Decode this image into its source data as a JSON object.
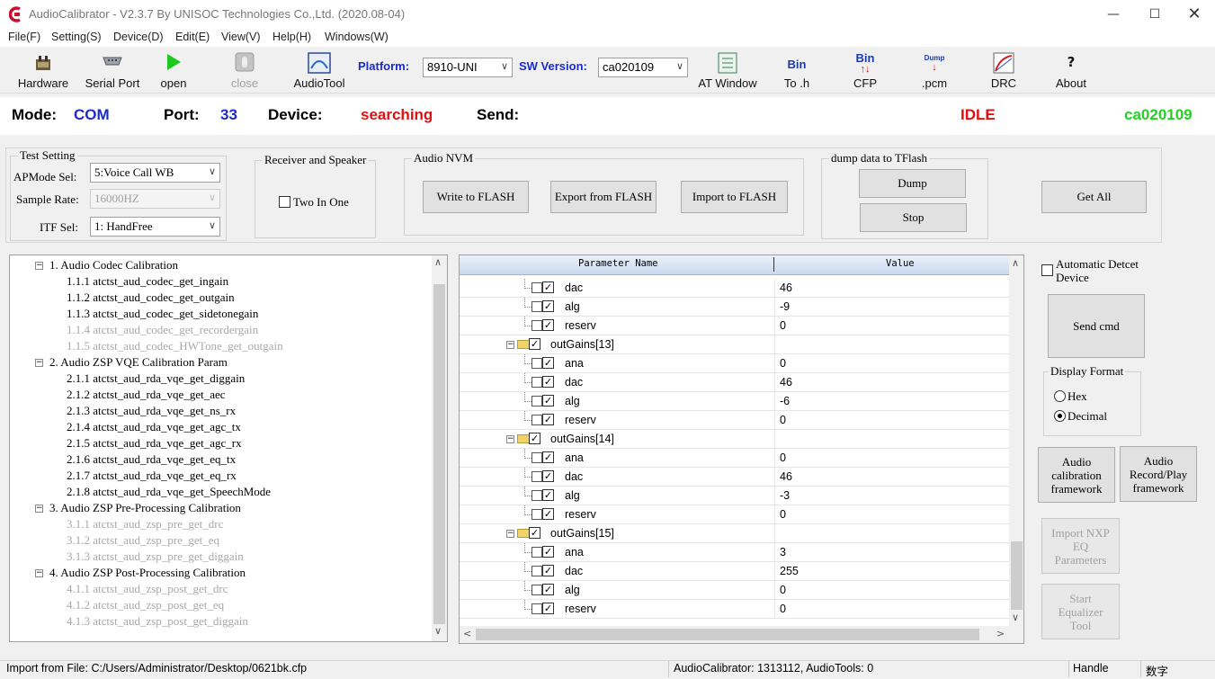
{
  "window": {
    "title": "AudioCalibrator - V2.3.7 By UNISOC Technologies Co.,Ltd. (2020.08-04)"
  },
  "menu": [
    "File(F)",
    "Setting(S)",
    "Device(D)",
    "Edit(E)",
    "View(V)",
    "Help(H)",
    "Windows(W)"
  ],
  "toolbar": {
    "hardware": "Hardware",
    "serial_port": "Serial Port",
    "open": "open",
    "close": "close",
    "audiotool": "AudioTool",
    "platform_label": "Platform:",
    "platform_value": "8910-UNI",
    "sw_label": "SW Version:",
    "sw_value": "ca020109",
    "at_window": "AT Window",
    "bin_icon": "Bin",
    "to_h": "To .h",
    "cfp_icon": "Bin",
    "cfp": "CFP",
    "dump_icon": "Dump",
    "pcm": ".pcm",
    "drc": "DRC",
    "about": "About"
  },
  "status": {
    "mode_label": "Mode:",
    "mode_value": "COM",
    "port_label": "Port:",
    "port_value": "33",
    "device_label": "Device:",
    "device_value": "searching",
    "send_label": "Send:",
    "state": "IDLE",
    "version": "ca020109"
  },
  "test_setting": {
    "title": "Test Setting",
    "apmode_label": "APMode Sel:",
    "apmode_value": "5:Voice Call WB",
    "sample_rate_label": "Sample Rate:",
    "sample_rate_value": "16000HZ",
    "itf_label": "ITF Sel:",
    "itf_value": "1: HandFree"
  },
  "receiver": {
    "title": "Receiver and Speaker",
    "two_in_one": "Two In One"
  },
  "nvm": {
    "title": "Audio NVM",
    "write": "Write to FLASH",
    "export": "Export from FLASH",
    "import": "Import to FLASH"
  },
  "dump": {
    "title": "dump data to TFlash",
    "dump": "Dump",
    "stop": "Stop"
  },
  "get_all": "Get All",
  "tree": [
    {
      "label": "1. Audio Codec Calibration",
      "level": 0,
      "disabled": false
    },
    {
      "label": "1.1.1 atctst_aud_codec_get_ingain",
      "level": 1,
      "disabled": false
    },
    {
      "label": "1.1.2 atctst_aud_codec_get_outgain",
      "level": 1,
      "disabled": false
    },
    {
      "label": "1.1.3 atctst_aud_codec_get_sidetonegain",
      "level": 1,
      "disabled": false
    },
    {
      "label": "1.1.4 atctst_aud_codec_get_recordergain",
      "level": 1,
      "disabled": true
    },
    {
      "label": "1.1.5 atctst_aud_codec_HWTone_get_outgain",
      "level": 1,
      "disabled": true
    },
    {
      "label": "2. Audio ZSP VQE Calibration Param",
      "level": 0,
      "disabled": false
    },
    {
      "label": "2.1.1 atctst_aud_rda_vqe_get_diggain",
      "level": 1,
      "disabled": false
    },
    {
      "label": "2.1.2 atctst_aud_rda_vqe_get_aec",
      "level": 1,
      "disabled": false
    },
    {
      "label": "2.1.3 atctst_aud_rda_vqe_get_ns_rx",
      "level": 1,
      "disabled": false
    },
    {
      "label": "2.1.4 atctst_aud_rda_vqe_get_agc_tx",
      "level": 1,
      "disabled": false
    },
    {
      "label": "2.1.5 atctst_aud_rda_vqe_get_agc_rx",
      "level": 1,
      "disabled": false
    },
    {
      "label": "2.1.6 atctst_aud_rda_vqe_get_eq_tx",
      "level": 1,
      "disabled": false
    },
    {
      "label": "2.1.7 atctst_aud_rda_vqe_get_eq_rx",
      "level": 1,
      "disabled": false
    },
    {
      "label": "2.1.8 atctst_aud_rda_vqe_get_SpeechMode",
      "level": 1,
      "disabled": false
    },
    {
      "label": "3. Audio ZSP Pre-Processing Calibration",
      "level": 0,
      "disabled": false
    },
    {
      "label": "3.1.1 atctst_aud_zsp_pre_get_drc",
      "level": 1,
      "disabled": true
    },
    {
      "label": "3.1.2 atctst_aud_zsp_pre_get_eq",
      "level": 1,
      "disabled": true
    },
    {
      "label": "3.1.3 atctst_aud_zsp_pre_get_diggain",
      "level": 1,
      "disabled": true
    },
    {
      "label": "4. Audio ZSP Post-Processing Calibration",
      "level": 0,
      "disabled": false
    },
    {
      "label": "4.1.1 atctst_aud_zsp_post_get_drc",
      "level": 1,
      "disabled": true
    },
    {
      "label": "4.1.2 atctst_aud_zsp_post_get_eq",
      "level": 1,
      "disabled": true
    },
    {
      "label": "4.1.3 atctst_aud_zsp_post_get_diggain",
      "level": 1,
      "disabled": true
    }
  ],
  "grid": {
    "headers": [
      "Parameter Name",
      "Value"
    ],
    "rows": [
      {
        "name": "dac",
        "value": "46",
        "group": false
      },
      {
        "name": "alg",
        "value": "-9",
        "group": false
      },
      {
        "name": "reserv",
        "value": "0",
        "group": false
      },
      {
        "name": "outGains[13]",
        "value": "",
        "group": true
      },
      {
        "name": "ana",
        "value": "0",
        "group": false
      },
      {
        "name": "dac",
        "value": "46",
        "group": false
      },
      {
        "name": "alg",
        "value": "-6",
        "group": false
      },
      {
        "name": "reserv",
        "value": "0",
        "group": false
      },
      {
        "name": "outGains[14]",
        "value": "",
        "group": true
      },
      {
        "name": "ana",
        "value": "0",
        "group": false
      },
      {
        "name": "dac",
        "value": "46",
        "group": false
      },
      {
        "name": "alg",
        "value": "-3",
        "group": false
      },
      {
        "name": "reserv",
        "value": "0",
        "group": false
      },
      {
        "name": "outGains[15]",
        "value": "",
        "group": true
      },
      {
        "name": "ana",
        "value": "3",
        "group": false
      },
      {
        "name": "dac",
        "value": "255",
        "group": false
      },
      {
        "name": "alg",
        "value": "0",
        "group": false
      },
      {
        "name": "reserv",
        "value": "0",
        "group": false
      }
    ]
  },
  "right": {
    "auto_detect": "Automatic Detcet Device",
    "send_cmd": "Send cmd",
    "display_format": "Display Format",
    "hex": "Hex",
    "decimal": "Decimal",
    "audio_cal_fw": "Audio calibration framework",
    "audio_rec_fw": "Audio Record/Play framework",
    "import_nxp": "Import NXP EQ Parameters",
    "start_eq": "Start Equalizer Tool"
  },
  "statusbar": {
    "file": "Import from File: C:/Users/Administrator/Desktop/0621bk.cfp",
    "versions": "AudioCalibrator: 1313112, AudioTools: 0",
    "handle": "Handle",
    "ime": "数字"
  },
  "colors": {
    "blue": "#1a2ad0",
    "red": "#e01010",
    "green": "#22d022"
  }
}
